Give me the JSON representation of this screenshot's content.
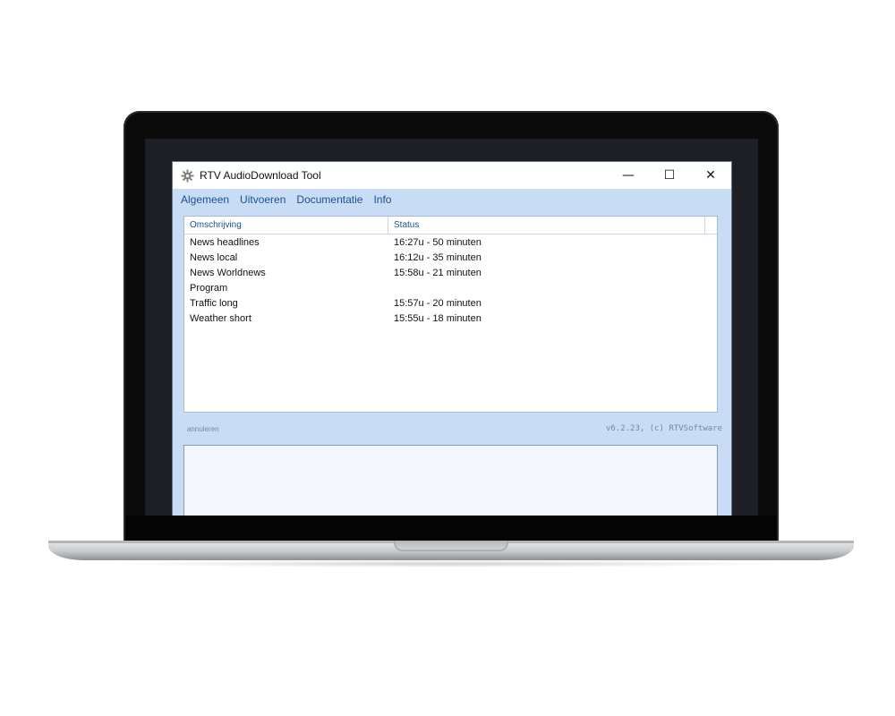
{
  "window": {
    "title": "RTV AudioDownload Tool",
    "icon": "gear-icon",
    "controls": {
      "minimize": "—",
      "maximize": "☐",
      "close": "✕"
    }
  },
  "menu": {
    "items": [
      {
        "label": "Algemeen"
      },
      {
        "label": "Uitvoeren"
      },
      {
        "label": "Documentatie"
      },
      {
        "label": "Info"
      }
    ]
  },
  "list": {
    "columns": [
      "Omschrijving",
      "Status"
    ],
    "rows": [
      {
        "description": "News headlines",
        "status": "16:27u - 50 minuten"
      },
      {
        "description": "News local",
        "status": "16:12u - 35 minuten"
      },
      {
        "description": "News Worldnews",
        "status": "15:58u - 21 minuten"
      },
      {
        "description": "Program",
        "status": ""
      },
      {
        "description": "Traffic long",
        "status": "15:57u - 20 minuten"
      },
      {
        "description": "Weather short",
        "status": "15:55u - 18 minuten"
      }
    ]
  },
  "status_bar": {
    "cancel_label": "annuleren",
    "version": "v6.2.23, (c) RTVSoftware"
  },
  "colors": {
    "window_background": "#c9dcf5",
    "menu_text": "#1d4f8f",
    "bezel": "#0b0b0c"
  }
}
